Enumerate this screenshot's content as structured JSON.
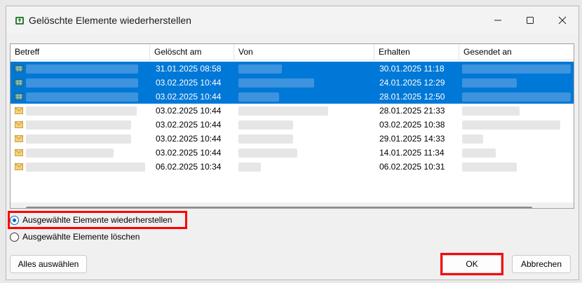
{
  "window": {
    "title": "Gelöschte Elemente wiederherstellen",
    "controls": {
      "minimize": "minimize",
      "maximize": "maximize",
      "close": "close"
    }
  },
  "list": {
    "columns": [
      "Betreff",
      "Gelöscht am",
      "Von",
      "Erhalten",
      "Gesendet an"
    ],
    "rows": [
      {
        "selected": true,
        "icon": "calendar-icon",
        "deleted": "31.01.2025 08:58",
        "received": "30.01.2025 11:18"
      },
      {
        "selected": true,
        "icon": "calendar-icon",
        "deleted": "03.02.2025 10:44",
        "received": "24.01.2025 12:29"
      },
      {
        "selected": true,
        "icon": "calendar-icon",
        "deleted": "03.02.2025 10:44",
        "received": "28.01.2025 12:50"
      },
      {
        "selected": false,
        "icon": "envelope-icon",
        "deleted": "03.02.2025 10:44",
        "received": "28.01.2025 21:33"
      },
      {
        "selected": false,
        "icon": "envelope-icon",
        "deleted": "03.02.2025 10:44",
        "received": "03.02.2025 10:38"
      },
      {
        "selected": false,
        "icon": "envelope-icon",
        "deleted": "03.02.2025 10:44",
        "received": "29.01.2025 14:33"
      },
      {
        "selected": false,
        "icon": "envelope-icon",
        "deleted": "03.02.2025 10:44",
        "received": "14.01.2025 11:34"
      },
      {
        "selected": false,
        "icon": "envelope-icon",
        "deleted": "06.02.2025 10:34",
        "received": "06.02.2025 10:31"
      }
    ]
  },
  "options": {
    "restore_label": "Ausgewählte Elemente wiederherstellen",
    "delete_label": "Ausgewählte Elemente löschen",
    "selected": "restore"
  },
  "buttons": {
    "select_all": "Alles auswählen",
    "ok": "OK",
    "cancel": "Abbrechen"
  },
  "colors": {
    "selection": "#0078d7",
    "highlight": "#ff0000"
  }
}
